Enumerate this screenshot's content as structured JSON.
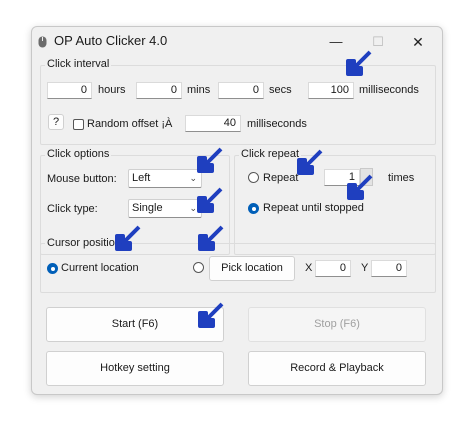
{
  "window": {
    "title": "OP Auto Clicker 4.0",
    "minimize": "—",
    "maximize": "☐",
    "close": "✕"
  },
  "click_interval": {
    "group_label": "Click interval",
    "hours_value": "0",
    "hours_label": "hours",
    "mins_value": "0",
    "mins_label": "mins",
    "secs_value": "0",
    "secs_label": "secs",
    "ms_value": "100",
    "ms_label": "milliseconds",
    "help_label": "?",
    "random_offset_label": "Random offset ¡À",
    "random_offset_value": "40",
    "random_offset_unit": "milliseconds"
  },
  "click_options": {
    "group_label": "Click options",
    "mouse_button_label": "Mouse button:",
    "mouse_button_value": "Left",
    "click_type_label": "Click type:",
    "click_type_value": "Single"
  },
  "click_repeat": {
    "group_label": "Click repeat",
    "repeat_label": "Repeat",
    "repeat_count": "1",
    "times_label": "times",
    "repeat_until_stopped_label": "Repeat until stopped"
  },
  "cursor_position": {
    "group_label": "Cursor position",
    "current_location_label": "Current location",
    "pick_location_label": "Pick location",
    "x_label": "X",
    "x_value": "0",
    "y_label": "Y",
    "y_value": "0"
  },
  "actions": {
    "start_label": "Start (F6)",
    "stop_label": "Stop (F6)",
    "hotkey_label": "Hotkey setting",
    "record_label": "Record & Playback"
  },
  "colors": {
    "annotation_arrow": "#1f3fbf",
    "accent": "#005fb8",
    "window_bg": "#f0f0f0"
  }
}
